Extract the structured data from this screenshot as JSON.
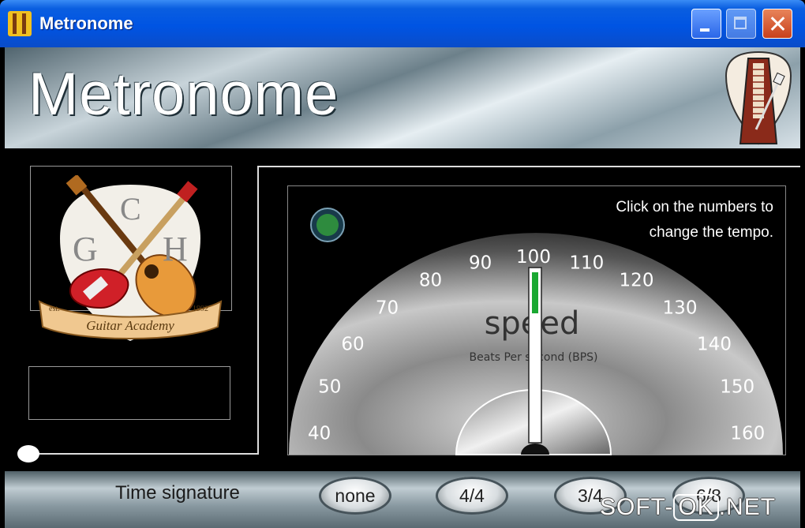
{
  "window": {
    "title": "Metronome"
  },
  "titlebar": {
    "minimize_icon": "minimize-icon",
    "maximize_icon": "maximize-icon",
    "close_icon": "close-icon"
  },
  "header": {
    "title": "Metronome",
    "logo_icon": "metronome-icon"
  },
  "logo": {
    "letter_left": "G",
    "letter_top": "C",
    "letter_right": "H",
    "ribbon_text": "Guitar Academy",
    "est": "est.",
    "year": "1992"
  },
  "instructions": {
    "line1": "Click on the numbers to",
    "line2": "change the tempo."
  },
  "dial": {
    "speed_label": "speed",
    "speed_sublabel": "Beats Per second (BPS)",
    "current_tempo": 100,
    "ticks": [
      "40",
      "50",
      "60",
      "70",
      "80",
      "90",
      "100",
      "110",
      "120",
      "130",
      "140",
      "150",
      "160"
    ],
    "indicator_color": "#2e8b3e"
  },
  "footer": {
    "label": "Time signature",
    "buttons": [
      {
        "label": "none"
      },
      {
        "label": "4/4"
      },
      {
        "label": "3/4"
      },
      {
        "label": "6/8"
      }
    ]
  },
  "watermark": {
    "pre": "SOFT-",
    "mid": "OK",
    "post": ".NET"
  }
}
